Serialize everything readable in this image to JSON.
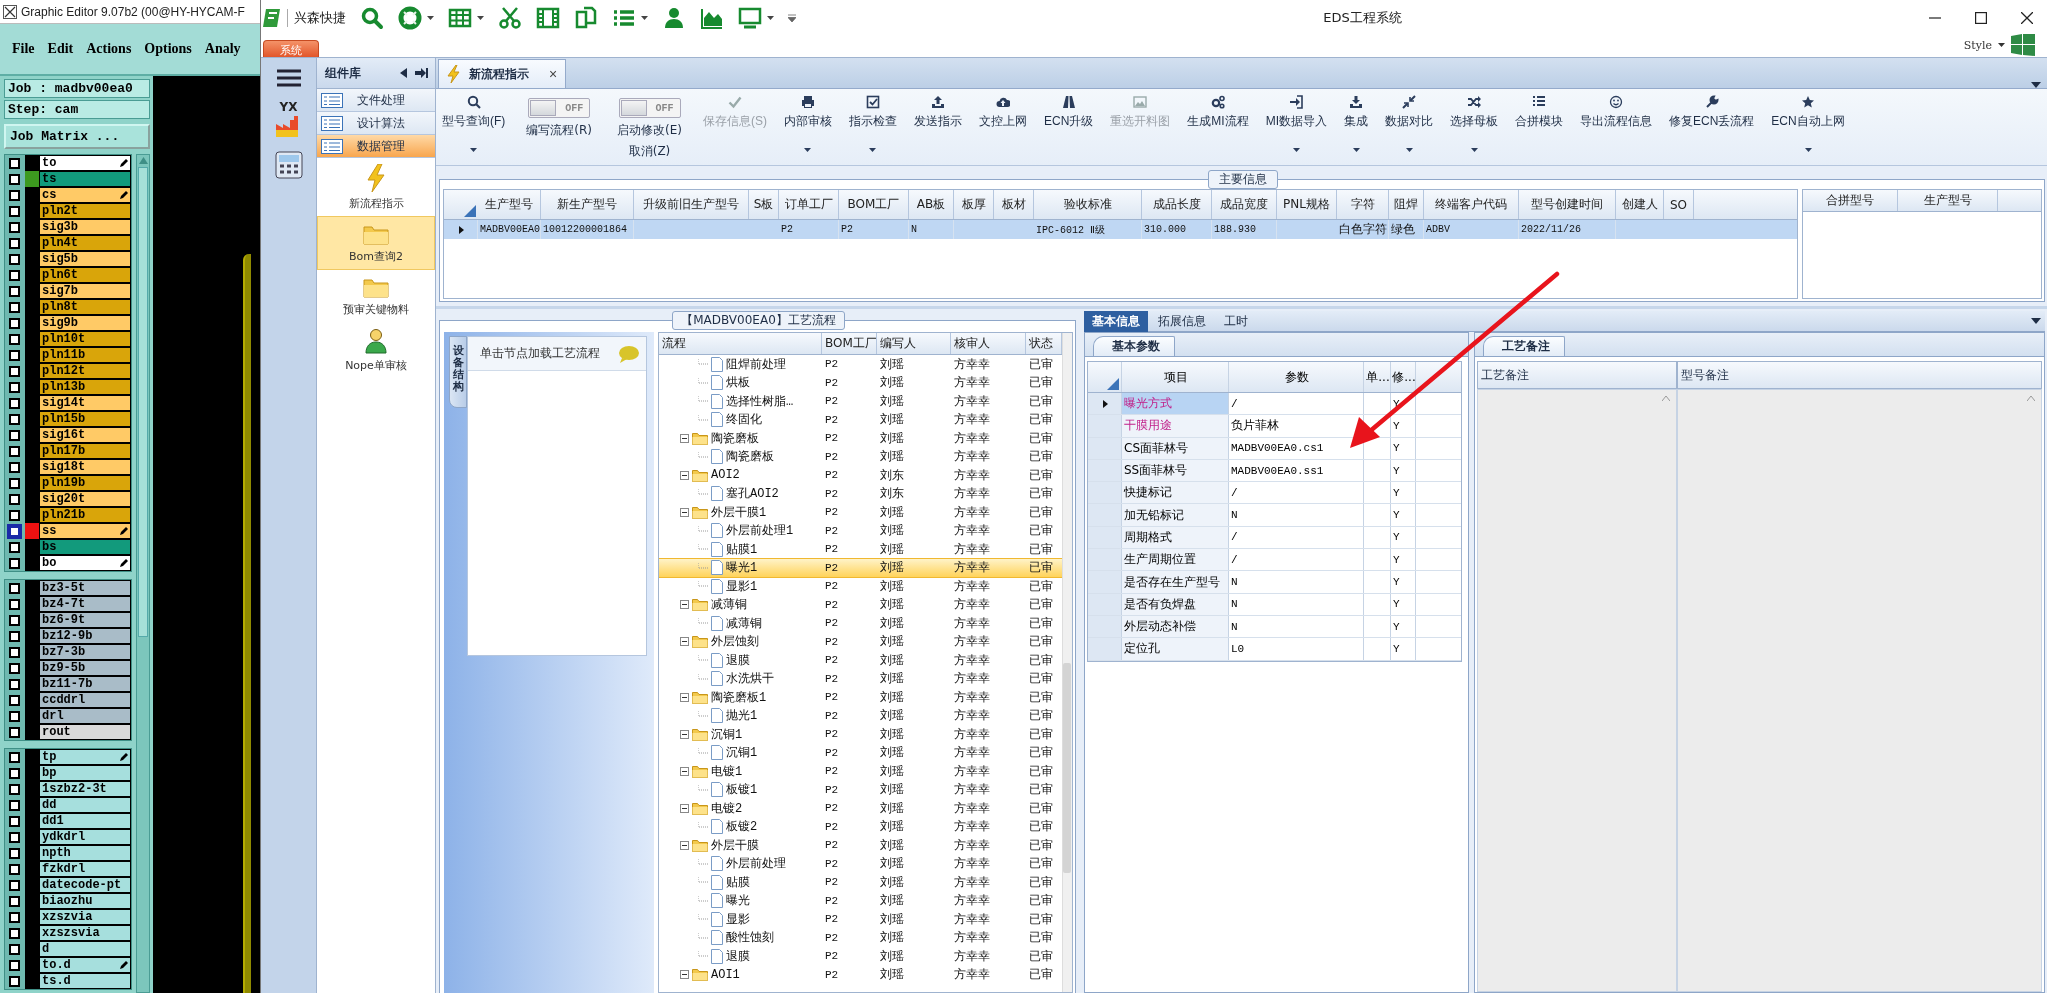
{
  "graphic_editor": {
    "title": "Graphic Editor 9.07b2 (00@HY-HYCAM-F",
    "menu": [
      "File",
      "Edit",
      "Actions",
      "Options",
      "Analy"
    ],
    "job": "Job : madbv00ea0",
    "step": "Step: cam",
    "matrix_button": "Job Matrix ...",
    "layer_groups": [
      {
        "layers": [
          {
            "name": "to",
            "color": "#ffffff",
            "checked": false,
            "edit_mark": true,
            "displayed": false,
            "work": false
          },
          {
            "name": "ts",
            "color": "#129a7c",
            "checked": false,
            "edit_mark": false,
            "displayed": true,
            "work": false
          },
          {
            "name": "cs",
            "color": "#ffca66",
            "checked": false,
            "edit_mark": true,
            "displayed": false,
            "work": false
          },
          {
            "name": "pln2t",
            "color": "#d9a50a",
            "checked": false,
            "edit_mark": false,
            "displayed": false,
            "work": false
          },
          {
            "name": "sig3b",
            "color": "#ffca66",
            "checked": false,
            "edit_mark": false,
            "displayed": false,
            "work": false
          },
          {
            "name": "pln4t",
            "color": "#d9a50a",
            "checked": false,
            "edit_mark": false,
            "displayed": false,
            "work": false
          },
          {
            "name": "sig5b",
            "color": "#ffca66",
            "checked": false,
            "edit_mark": false,
            "displayed": false,
            "work": false
          },
          {
            "name": "pln6t",
            "color": "#d9a50a",
            "checked": false,
            "edit_mark": false,
            "displayed": false,
            "work": false
          },
          {
            "name": "sig7b",
            "color": "#ffca66",
            "checked": false,
            "edit_mark": false,
            "displayed": false,
            "work": false
          },
          {
            "name": "pln8t",
            "color": "#d9a50a",
            "checked": false,
            "edit_mark": false,
            "displayed": false,
            "work": false
          },
          {
            "name": "sig9b",
            "color": "#ffca66",
            "checked": false,
            "edit_mark": false,
            "displayed": false,
            "work": false
          },
          {
            "name": "pln10t",
            "color": "#d9a50a",
            "checked": false,
            "edit_mark": false,
            "displayed": false,
            "work": false
          },
          {
            "name": "pln11b",
            "color": "#d9a50a",
            "checked": false,
            "edit_mark": false,
            "displayed": false,
            "work": false
          },
          {
            "name": "pln12t",
            "color": "#d9a50a",
            "checked": false,
            "edit_mark": false,
            "displayed": false,
            "work": false
          },
          {
            "name": "pln13b",
            "color": "#d9a50a",
            "checked": false,
            "edit_mark": false,
            "displayed": false,
            "work": false
          },
          {
            "name": "sig14t",
            "color": "#ffca66",
            "checked": false,
            "edit_mark": false,
            "displayed": false,
            "work": false
          },
          {
            "name": "pln15b",
            "color": "#d9a50a",
            "checked": false,
            "edit_mark": false,
            "displayed": false,
            "work": false
          },
          {
            "name": "sig16t",
            "color": "#ffca66",
            "checked": false,
            "edit_mark": false,
            "displayed": false,
            "work": false
          },
          {
            "name": "pln17b",
            "color": "#d9a50a",
            "checked": false,
            "edit_mark": false,
            "displayed": false,
            "work": false
          },
          {
            "name": "sig18t",
            "color": "#ffca66",
            "checked": false,
            "edit_mark": false,
            "displayed": false,
            "work": false
          },
          {
            "name": "pln19b",
            "color": "#d9a50a",
            "checked": false,
            "edit_mark": false,
            "displayed": false,
            "work": false
          },
          {
            "name": "sig20t",
            "color": "#ffca66",
            "checked": false,
            "edit_mark": false,
            "displayed": false,
            "work": false
          },
          {
            "name": "pln21b",
            "color": "#d9a50a",
            "checked": false,
            "edit_mark": false,
            "displayed": false,
            "work": false
          },
          {
            "name": "ss",
            "color": "#ffca66",
            "checked": false,
            "edit_mark": true,
            "displayed": false,
            "work": true
          },
          {
            "name": "bs",
            "color": "#129a7c",
            "checked": false,
            "edit_mark": false,
            "displayed": false,
            "work": false
          },
          {
            "name": "bo",
            "color": "#ffffff",
            "checked": false,
            "edit_mark": true,
            "displayed": false,
            "work": false
          }
        ]
      },
      {
        "layers": [
          {
            "name": "bz3-5t",
            "color": "#a9bcc8",
            "checked": false,
            "edit_mark": false,
            "displayed": false,
            "work": false
          },
          {
            "name": "bz4-7t",
            "color": "#a9bcc8",
            "checked": false,
            "edit_mark": false,
            "displayed": false,
            "work": false
          },
          {
            "name": "bz6-9t",
            "color": "#a9bcc8",
            "checked": false,
            "edit_mark": false,
            "displayed": false,
            "work": false
          },
          {
            "name": "bz12-9b",
            "color": "#a9bcc8",
            "checked": false,
            "edit_mark": false,
            "displayed": false,
            "work": false
          },
          {
            "name": "bz7-3b",
            "color": "#a9bcc8",
            "checked": false,
            "edit_mark": false,
            "displayed": false,
            "work": false
          },
          {
            "name": "bz9-5b",
            "color": "#a9bcc8",
            "checked": false,
            "edit_mark": false,
            "displayed": false,
            "work": false
          },
          {
            "name": "bz11-7b",
            "color": "#a9bcc8",
            "checked": false,
            "edit_mark": false,
            "displayed": false,
            "work": false
          },
          {
            "name": "ccddrl",
            "color": "#a9bcc8",
            "checked": false,
            "edit_mark": false,
            "displayed": false,
            "work": false
          },
          {
            "name": "drl",
            "color": "#a9bcc8",
            "checked": false,
            "edit_mark": false,
            "displayed": false,
            "work": false
          },
          {
            "name": "rout",
            "color": "#dadada",
            "checked": false,
            "edit_mark": false,
            "displayed": false,
            "work": false
          }
        ]
      },
      {
        "layers": [
          {
            "name": "tp",
            "color": "#a6dfdd",
            "checked": false,
            "edit_mark": true,
            "displayed": false,
            "work": false
          },
          {
            "name": "bp",
            "color": "#a6dfdd",
            "checked": false,
            "edit_mark": false,
            "displayed": false,
            "work": false
          },
          {
            "name": "1szbz2-3t",
            "color": "#a6dfdd",
            "checked": false,
            "edit_mark": false,
            "displayed": false,
            "work": false
          },
          {
            "name": "dd",
            "color": "#a6dfdd",
            "checked": false,
            "edit_mark": false,
            "displayed": false,
            "work": false
          },
          {
            "name": "dd1",
            "color": "#a6dfdd",
            "checked": false,
            "edit_mark": false,
            "displayed": false,
            "work": false
          },
          {
            "name": "ydkdrl",
            "color": "#a6dfdd",
            "checked": false,
            "edit_mark": false,
            "displayed": false,
            "work": false
          },
          {
            "name": "npth",
            "color": "#a6dfdd",
            "checked": false,
            "edit_mark": false,
            "displayed": false,
            "work": false
          },
          {
            "name": "fzkdrl",
            "color": "#a6dfdd",
            "checked": false,
            "edit_mark": false,
            "displayed": false,
            "work": false
          },
          {
            "name": "datecode-pt",
            "color": "#a6dfdd",
            "checked": false,
            "edit_mark": false,
            "displayed": false,
            "work": false
          },
          {
            "name": "biaozhu",
            "color": "#a6dfdd",
            "checked": false,
            "edit_mark": false,
            "displayed": false,
            "work": false
          },
          {
            "name": "xzszvia",
            "color": "#a6dfdd",
            "checked": false,
            "edit_mark": false,
            "displayed": false,
            "work": false
          },
          {
            "name": "xzszsvia",
            "color": "#a6dfdd",
            "checked": false,
            "edit_mark": false,
            "displayed": false,
            "work": false
          },
          {
            "name": "d",
            "color": "#a6dfdd",
            "checked": false,
            "edit_mark": false,
            "displayed": false,
            "work": false
          },
          {
            "name": "to.d",
            "color": "#a6dfdd",
            "checked": false,
            "edit_mark": true,
            "displayed": false,
            "work": false
          },
          {
            "name": "ts.d",
            "color": "#a6dfdd",
            "checked": false,
            "edit_mark": false,
            "displayed": false,
            "work": false
          }
        ]
      }
    ]
  },
  "eds": {
    "brand": "兴森快捷",
    "title": "EDS工程系统",
    "app_tab": "系统",
    "style_menu": "Style",
    "nav_badge": "YX",
    "library": {
      "title": "组件库",
      "categories": [
        {
          "label": "文件处理",
          "selected": false
        },
        {
          "label": "设计算法",
          "selected": false
        },
        {
          "label": "数据管理",
          "selected": true
        }
      ],
      "tools": [
        {
          "label": "新流程指示",
          "selected": false
        },
        {
          "label": "Bom查询2",
          "selected": true
        },
        {
          "label": "预审关键物料",
          "selected": false
        },
        {
          "label": "Nope单审核",
          "selected": false
        }
      ]
    },
    "document_tab": {
      "label": "新流程指示",
      "close": "×"
    },
    "ribbon": [
      {
        "kind": "button",
        "label": "型号查询(F)",
        "dropdown": true,
        "disabled": false
      },
      {
        "kind": "toggle",
        "switch_text": "OFF",
        "on": false,
        "label": "编写流程(R)"
      },
      {
        "kind": "toggle",
        "switch_text": "OFF",
        "on": false,
        "label": "启动修改(E)",
        "second_line": "取消(Z)"
      },
      {
        "kind": "button",
        "label": "保存信息(S)",
        "dropdown": false,
        "disabled": true
      },
      {
        "kind": "button",
        "label": "内部审核",
        "dropdown": true,
        "disabled": false
      },
      {
        "kind": "button",
        "label": "指示检查",
        "dropdown": true,
        "disabled": false
      },
      {
        "kind": "button",
        "label": "发送指示",
        "dropdown": false,
        "disabled": false
      },
      {
        "kind": "button",
        "label": "文控上网",
        "dropdown": false,
        "disabled": false
      },
      {
        "kind": "button",
        "label": "ECN升级",
        "dropdown": false,
        "disabled": false
      },
      {
        "kind": "button",
        "label": "重选开料图",
        "dropdown": false,
        "disabled": true
      },
      {
        "kind": "button",
        "label": "生成MI流程",
        "dropdown": false,
        "disabled": false
      },
      {
        "kind": "button",
        "label": "MI数据导入",
        "dropdown": true,
        "disabled": false
      },
      {
        "kind": "button",
        "label": "集成",
        "dropdown": true,
        "disabled": false
      },
      {
        "kind": "button",
        "label": "数据对比",
        "dropdown": true,
        "disabled": false
      },
      {
        "kind": "button",
        "label": "选择母板",
        "dropdown": true,
        "disabled": false
      },
      {
        "kind": "button",
        "label": "合拼模块",
        "dropdown": false,
        "disabled": false
      },
      {
        "kind": "button",
        "label": "导出流程信息",
        "dropdown": false,
        "disabled": false
      },
      {
        "kind": "button",
        "label": "修复ECN丢流程",
        "dropdown": false,
        "disabled": false
      },
      {
        "kind": "button",
        "label": "ECN自动上网",
        "dropdown": true,
        "disabled": false
      }
    ],
    "main_info": {
      "title": "主要信息",
      "columns": [
        "生产型号",
        "新生产型号",
        "升级前旧生产型号",
        "S板",
        "订单工厂",
        "BOM工厂",
        "AB板",
        "板厚",
        "板材",
        "验收标准",
        "成品长度",
        "成品宽度",
        "PNL规格",
        "字符",
        "阻焊",
        "终端客户代码",
        "型号创建时间",
        "创建人",
        "SO"
      ],
      "rows": [
        {
          "selected": true,
          "cells": [
            "MADBV00EA0",
            "10012200001864",
            null,
            null,
            "P2",
            "P2",
            "N",
            null,
            null,
            "IPC-6012 Ⅱ级",
            "310.000",
            "188.930",
            null,
            "白色字符",
            "绿色",
            "ADBV",
            "2022/11/26",
            null,
            null
          ]
        }
      ],
      "merge_columns": [
        "合拼型号",
        "生产型号"
      ]
    },
    "process_flow": {
      "title": "【MADBV00EA0】工艺流程",
      "side_tab": "设备结构",
      "hint": "单击节点加载工艺流程",
      "columns": [
        "流程",
        "BOM工厂",
        "编写人",
        "核审人",
        "状态"
      ],
      "tree": [
        {
          "children": [
            {
              "name": "阻焊前处理",
              "bom": "P2",
              "writer": "刘瑶",
              "reviewer": "方幸幸",
              "status": "已审",
              "selected": false
            },
            {
              "name": "烘板",
              "bom": "P2",
              "writer": "刘瑶",
              "reviewer": "方幸幸",
              "status": "已审",
              "selected": false
            },
            {
              "name": "选择性树脂…",
              "bom": "P2",
              "writer": "刘瑶",
              "reviewer": "方幸幸",
              "status": "已审",
              "selected": false
            },
            {
              "name": "终固化",
              "bom": "P2",
              "writer": "刘瑶",
              "reviewer": "方幸幸",
              "status": "已审",
              "selected": false
            }
          ]
        },
        {
          "name": "陶瓷磨板",
          "bom": "P2",
          "writer": "刘瑶",
          "reviewer": "方幸幸",
          "status": "已审",
          "selected": false,
          "expanded": true,
          "children": [
            {
              "name": "陶瓷磨板",
              "bom": "P2",
              "writer": "刘瑶",
              "reviewer": "方幸幸",
              "status": "已审",
              "selected": false
            }
          ]
        },
        {
          "name": "AOI2",
          "bom": "P2",
          "writer": "刘东",
          "reviewer": "方幸幸",
          "status": "已审",
          "selected": false,
          "expanded": true,
          "children": [
            {
              "name": "塞孔AOI2",
              "bom": "P2",
              "writer": "刘东",
              "reviewer": "方幸幸",
              "status": "已审",
              "selected": false
            }
          ]
        },
        {
          "name": "外层干膜1",
          "bom": "P2",
          "writer": "刘瑶",
          "reviewer": "方幸幸",
          "status": "已审",
          "selected": false,
          "expanded": true,
          "children": [
            {
              "name": "外层前处理1",
              "bom": "P2",
              "writer": "刘瑶",
              "reviewer": "方幸幸",
              "status": "已审",
              "selected": false
            },
            {
              "name": "贴膜1",
              "bom": "P2",
              "writer": "刘瑶",
              "reviewer": "方幸幸",
              "status": "已审",
              "selected": false
            },
            {
              "name": "曝光1",
              "bom": "P2",
              "writer": "刘瑶",
              "reviewer": "方幸幸",
              "status": "已审",
              "selected": true
            },
            {
              "name": "显影1",
              "bom": "P2",
              "writer": "刘瑶",
              "reviewer": "方幸幸",
              "status": "已审",
              "selected": false
            }
          ]
        },
        {
          "name": "减薄铜",
          "bom": "P2",
          "writer": "刘瑶",
          "reviewer": "方幸幸",
          "status": "已审",
          "selected": false,
          "expanded": true,
          "children": [
            {
              "name": "减薄铜",
              "bom": "P2",
              "writer": "刘瑶",
              "reviewer": "方幸幸",
              "status": "已审",
              "selected": false
            }
          ]
        },
        {
          "name": "外层蚀刻",
          "bom": "P2",
          "writer": "刘瑶",
          "reviewer": "方幸幸",
          "status": "已审",
          "selected": false,
          "expanded": true,
          "children": [
            {
              "name": "退膜",
              "bom": "P2",
              "writer": "刘瑶",
              "reviewer": "方幸幸",
              "status": "已审",
              "selected": false
            },
            {
              "name": "水洗烘干",
              "bom": "P2",
              "writer": "刘瑶",
              "reviewer": "方幸幸",
              "status": "已审",
              "selected": false
            }
          ]
        },
        {
          "name": "陶瓷磨板1",
          "bom": "P2",
          "writer": "刘瑶",
          "reviewer": "方幸幸",
          "status": "已审",
          "selected": false,
          "expanded": true,
          "children": [
            {
              "name": "抛光1",
              "bom": "P2",
              "writer": "刘瑶",
              "reviewer": "方幸幸",
              "status": "已审",
              "selected": false
            }
          ]
        },
        {
          "name": "沉铜1",
          "bom": "P2",
          "writer": "刘瑶",
          "reviewer": "方幸幸",
          "status": "已审",
          "selected": false,
          "expanded": true,
          "children": [
            {
              "name": "沉铜1",
              "bom": "P2",
              "writer": "刘瑶",
              "reviewer": "方幸幸",
              "status": "已审",
              "selected": false
            }
          ]
        },
        {
          "name": "电镀1",
          "bom": "P2",
          "writer": "刘瑶",
          "reviewer": "方幸幸",
          "status": "已审",
          "selected": false,
          "expanded": true,
          "children": [
            {
              "name": "板镀1",
              "bom": "P2",
              "writer": "刘瑶",
              "reviewer": "方幸幸",
              "status": "已审",
              "selected": false
            }
          ]
        },
        {
          "name": "电镀2",
          "bom": "P2",
          "writer": "刘瑶",
          "reviewer": "方幸幸",
          "status": "已审",
          "selected": false,
          "expanded": true,
          "children": [
            {
              "name": "板镀2",
              "bom": "P2",
              "writer": "刘瑶",
              "reviewer": "方幸幸",
              "status": "已审",
              "selected": false
            }
          ]
        },
        {
          "name": "外层干膜",
          "bom": "P2",
          "writer": "刘瑶",
          "reviewer": "方幸幸",
          "status": "已审",
          "selected": false,
          "expanded": true,
          "children": [
            {
              "name": "外层前处理",
              "bom": "P2",
              "writer": "刘瑶",
              "reviewer": "方幸幸",
              "status": "已审",
              "selected": false
            },
            {
              "name": "贴膜",
              "bom": "P2",
              "writer": "刘瑶",
              "reviewer": "方幸幸",
              "status": "已审",
              "selected": false
            },
            {
              "name": "曝光",
              "bom": "P2",
              "writer": "刘瑶",
              "reviewer": "方幸幸",
              "status": "已审",
              "selected": false
            },
            {
              "name": "显影",
              "bom": "P2",
              "writer": "刘瑶",
              "reviewer": "方幸幸",
              "status": "已审",
              "selected": false
            },
            {
              "name": "酸性蚀刻",
              "bom": "P2",
              "writer": "刘瑶",
              "reviewer": "方幸幸",
              "status": "已审",
              "selected": false
            },
            {
              "name": "退膜",
              "bom": "P2",
              "writer": "刘瑶",
              "reviewer": "方幸幸",
              "status": "已审",
              "selected": false
            }
          ]
        },
        {
          "name": "AOI1",
          "bom": "P2",
          "writer": "刘瑶",
          "reviewer": "方幸幸",
          "status": "已审",
          "selected": false,
          "expanded": true
        }
      ]
    },
    "parameters": {
      "tabs": [
        {
          "label": "基本信息",
          "selected": true
        },
        {
          "label": "拓展信息",
          "selected": false
        },
        {
          "label": "工时",
          "selected": false
        }
      ],
      "sub_tab": "基本参数",
      "columns": [
        "项目",
        "参数",
        "单...",
        "修..."
      ],
      "rows": [
        {
          "item": "曝光方式",
          "value": "/",
          "modified": "Y",
          "required": true,
          "selected": true
        },
        {
          "item": "干膜用途",
          "value": "负片菲林",
          "modified": "Y",
          "required": true,
          "selected": false
        },
        {
          "item": "CS面菲林号",
          "value": "MADBV00EA0.cs1",
          "modified": "Y",
          "required": false,
          "selected": false
        },
        {
          "item": "SS面菲林号",
          "value": "MADBV00EA0.ss1",
          "modified": "Y",
          "required": false,
          "selected": false
        },
        {
          "item": "快捷标记",
          "value": "/",
          "modified": "Y",
          "required": false,
          "selected": false
        },
        {
          "item": "加无铅标记",
          "value": "N",
          "modified": "Y",
          "required": false,
          "selected": false
        },
        {
          "item": "周期格式",
          "value": "/",
          "modified": "Y",
          "required": false,
          "selected": false
        },
        {
          "item": "生产周期位置",
          "value": "/",
          "modified": "Y",
          "required": false,
          "selected": false
        },
        {
          "item": "是否存在生产型号",
          "value": "N",
          "modified": "Y",
          "required": false,
          "selected": false
        },
        {
          "item": "是否有负焊盘",
          "value": "N",
          "modified": "Y",
          "required": false,
          "selected": false
        },
        {
          "item": "外层动态补偿",
          "value": "N",
          "modified": "Y",
          "required": false,
          "selected": false
        },
        {
          "item": "定位孔",
          "value": "L0",
          "modified": "Y",
          "required": false,
          "selected": false
        }
      ],
      "remarks": {
        "tab": "工艺备注",
        "columns": [
          "工艺备注",
          "型号备注"
        ]
      }
    }
  }
}
